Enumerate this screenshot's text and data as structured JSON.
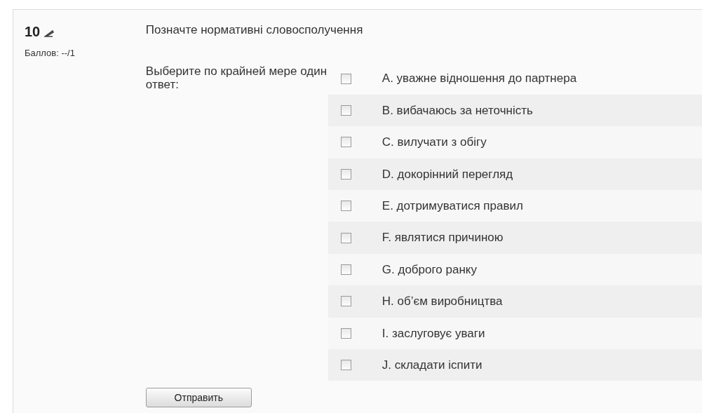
{
  "question": {
    "number": "10",
    "grade": "Баллов: --/1",
    "text": "Позначте нормативні словосполучення",
    "prompt": "Выберите по крайней мере один ответ:",
    "options": [
      {
        "label": "A. уважне відношення до партнера",
        "checked": false
      },
      {
        "label": "B. вибачаюсь за неточність",
        "checked": false
      },
      {
        "label": "C. вилучати з обігу",
        "checked": false
      },
      {
        "label": "D. докорінний перегляд",
        "checked": false
      },
      {
        "label": "E. дотримуватися правил",
        "checked": false
      },
      {
        "label": "F. являтися причиною",
        "checked": false
      },
      {
        "label": "G. доброго ранку",
        "checked": false
      },
      {
        "label": "H. об’єм виробництва",
        "checked": false
      },
      {
        "label": "I. заслуговує уваги",
        "checked": false
      },
      {
        "label": "J. складати іспити",
        "checked": false
      }
    ],
    "submit": "Отправить"
  }
}
